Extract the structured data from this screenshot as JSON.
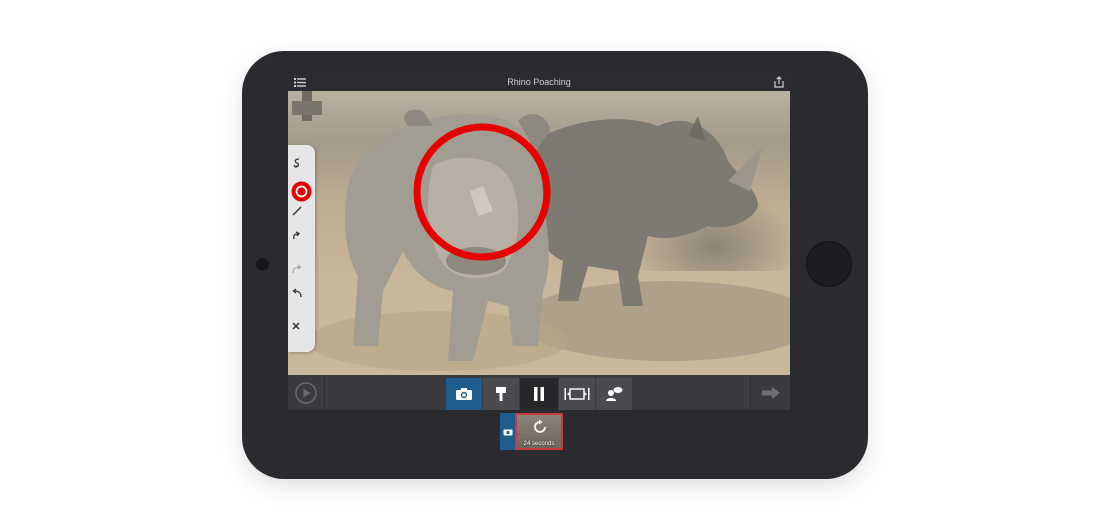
{
  "app": {
    "title": "Rhino Poaching"
  },
  "toolbar": {
    "tools": [
      "lasso-tool",
      "circle-tool",
      "line-tool",
      "arrow-tool",
      "redo",
      "undo",
      "clear"
    ],
    "selected": "circle-tool",
    "accent": "#e60000"
  },
  "annotation": {
    "shape": "circle",
    "color": "#e60000"
  },
  "controls": {
    "modes": [
      "camera",
      "brush",
      "pause",
      "fit-frame",
      "narrator"
    ],
    "active_mode": "camera",
    "accent": "#1f5d8e"
  },
  "timeline": {
    "clip_duration": "24 seconds"
  }
}
